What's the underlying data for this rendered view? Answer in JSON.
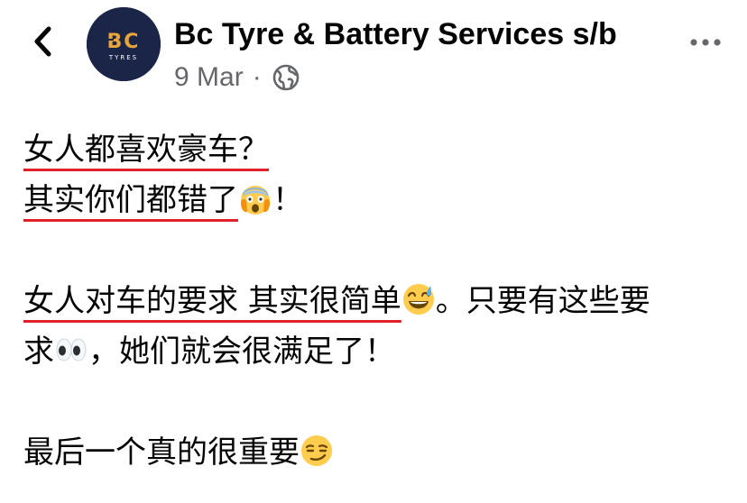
{
  "header": {
    "back_icon": "chevron-left-icon",
    "page_name": "Bc Tyre & Battery Services s/b",
    "logo_text": "BC",
    "logo_subtext": "TYRES",
    "date": "9 Mar",
    "separator": "·",
    "audience_icon": "globe-icon",
    "more_icon": "more-dots-icon"
  },
  "post": {
    "line1": "女人都喜欢豪车？",
    "line2_text": "其实你们都错了",
    "line2_emoji": "face-screaming-in-fear",
    "line2_tail": "！",
    "line3_text": "女人对车的要求 其实很简单",
    "line3_emoji": "grinning-face-with-sweat",
    "line3_tail": "。只要有这些要",
    "line4_head": "求",
    "line4_emoji": "eyes",
    "line4_text": "，她们就会很满足了！",
    "line5_text": "最后一个真的很重要",
    "line5_emoji": "smirking-face"
  },
  "colors": {
    "underline": "#e0212a",
    "secondary_text": "#65676b",
    "logo_bg": "#1b2548",
    "logo_accent": "#e8a53a"
  }
}
